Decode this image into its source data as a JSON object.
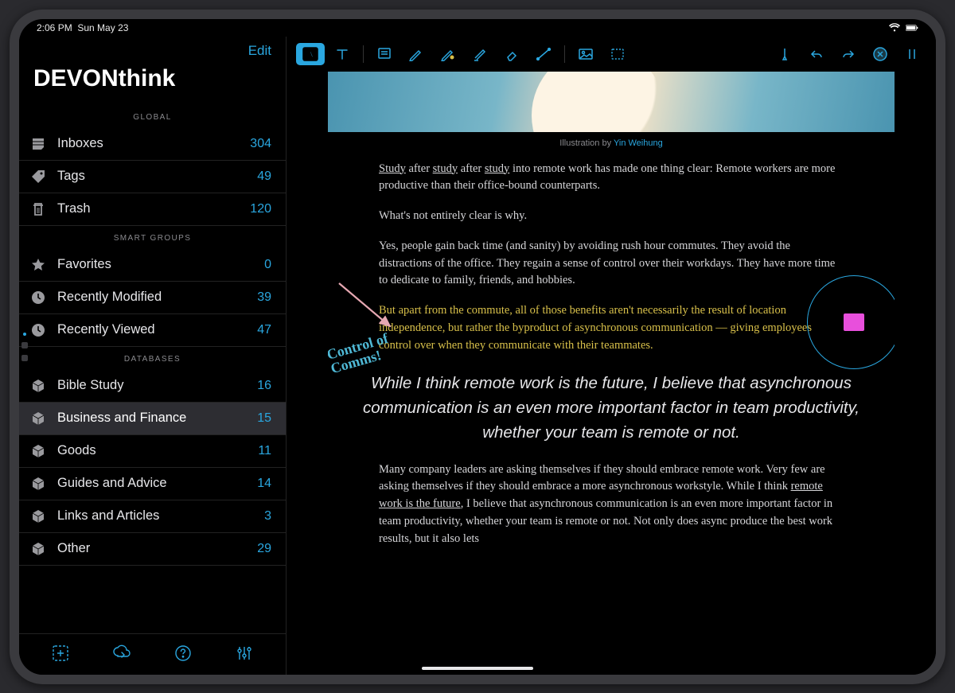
{
  "status": {
    "time": "2:06 PM",
    "date": "Sun May 23"
  },
  "sidebar": {
    "edit": "Edit",
    "title": "DEVONthink",
    "global_header": "GLOBAL",
    "global": [
      {
        "icon": "inbox-icon",
        "label": "Inboxes",
        "count": "304"
      },
      {
        "icon": "tag-icon",
        "label": "Tags",
        "count": "49"
      },
      {
        "icon": "trash-icon",
        "label": "Trash",
        "count": "120"
      }
    ],
    "smart_header": "SMART GROUPS",
    "smart": [
      {
        "icon": "star-icon",
        "label": "Favorites",
        "count": "0"
      },
      {
        "icon": "clock-icon",
        "label": "Recently Modified",
        "count": "39"
      },
      {
        "icon": "clock-icon",
        "label": "Recently Viewed",
        "count": "47"
      }
    ],
    "db_header": "DATABASES",
    "databases": [
      {
        "label": "Bible Study",
        "count": "16",
        "selected": false
      },
      {
        "label": "Business and Finance",
        "count": "15",
        "selected": true
      },
      {
        "label": "Goods",
        "count": "11",
        "selected": false
      },
      {
        "label": "Guides and Advice",
        "count": "14",
        "selected": false
      },
      {
        "label": "Links and Articles",
        "count": "3",
        "selected": false
      },
      {
        "label": "Other",
        "count": "29",
        "selected": false
      }
    ]
  },
  "document": {
    "illustration_by": "Illustration by ",
    "illustrator": "Yin Weihung",
    "p1a": "Study",
    "p1b": " after ",
    "p1c": "study",
    "p1d": " after ",
    "p1e": "study",
    "p1f": " into remote work has made one thing clear: Remote workers are more productive than their office-bound counterparts.",
    "p2": "What's not entirely clear is why.",
    "p3": "Yes, people gain back time (and sanity) by avoiding rush hour commutes. They avoid the distractions of the office. They regain a sense of control over their workdays. They have more time to dedicate to family, friends, and hobbies.",
    "p4": "But apart from the commute, all of those benefits aren't necessarily the result of location independence, but rather the byproduct of asynchronous communication — giving employees control over when they communicate with their teammates.",
    "quote": "While I think remote work is the future, I believe that asynchronous communication is an even more important factor in team productivity, whether your team is remote or not.",
    "p5a": "Many company leaders are asking themselves if they should embrace remote work. Very few are asking themselves if they should embrace a more asynchronous workstyle. While I think ",
    "p5link": "remote work is the future",
    "p5b": ", I believe that asynchronous communication is an even more important factor in team productivity, whether your team is remote or not. Not only does async produce the best work results, but it also lets",
    "handwriting_line1": "Control of",
    "handwriting_line2": "Comms!"
  }
}
